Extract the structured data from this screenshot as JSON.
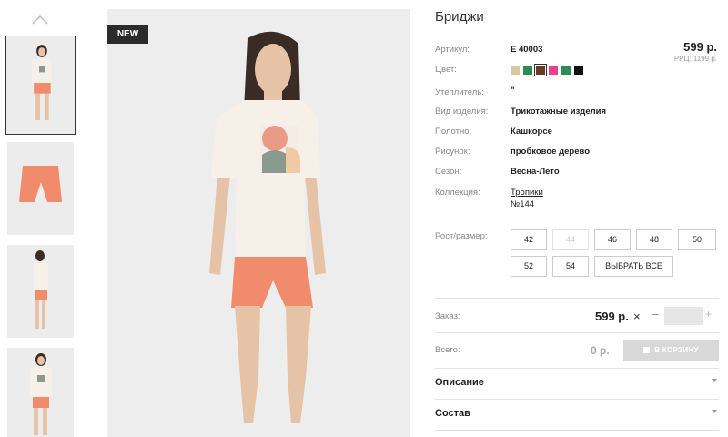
{
  "badge": "NEW",
  "product": {
    "title": "Бриджи",
    "price": "599 р.",
    "rrp": "РРЦ: 1199 р.",
    "attributes": {
      "article": {
        "label": "Артикул:",
        "value": "Е 40003"
      },
      "color": {
        "label": "Цвет:"
      },
      "insulation": {
        "label": "Утеплитель:",
        "value": "\""
      },
      "kind": {
        "label": "Вид изделия:",
        "value": "Трикотажные изделия"
      },
      "fabric": {
        "label": "Полотно:",
        "value": "Кашкорсе"
      },
      "pattern": {
        "label": "Рисунок:",
        "value": "пробковое дерево"
      },
      "season": {
        "label": "Сезон:",
        "value": "Весна-Лето"
      },
      "collection": {
        "label": "Коллекция:",
        "value": "Тропики",
        "value2": "№144"
      }
    },
    "swatches": [
      "#d9c9a3",
      "#2e8b57",
      "#6b3a2a",
      "#e8428c",
      "#2e8b57",
      "#111111"
    ],
    "selected_swatch": 2
  },
  "sizes": {
    "label": "Рост/размер:",
    "options": [
      "42",
      "44",
      "46",
      "48",
      "50",
      "52",
      "54"
    ],
    "disabled": [
      "44"
    ],
    "select_all": "ВЫБРАТЬ ВСЕ"
  },
  "order": {
    "label": "Заказ:",
    "price": "599 р.",
    "times": "×",
    "minus": "−",
    "plus": "+",
    "quantity": ""
  },
  "total": {
    "label": "Всего:",
    "price": "0 р.",
    "cart_button": "В КОРЗИНУ"
  },
  "accordions": [
    "Описание",
    "Состав"
  ],
  "colors": {
    "shorts": "#f08c6c",
    "tshirt": "#f7f0e9",
    "skin": "#e6c2a7",
    "hair": "#3a2b25",
    "background": "#ededed"
  }
}
